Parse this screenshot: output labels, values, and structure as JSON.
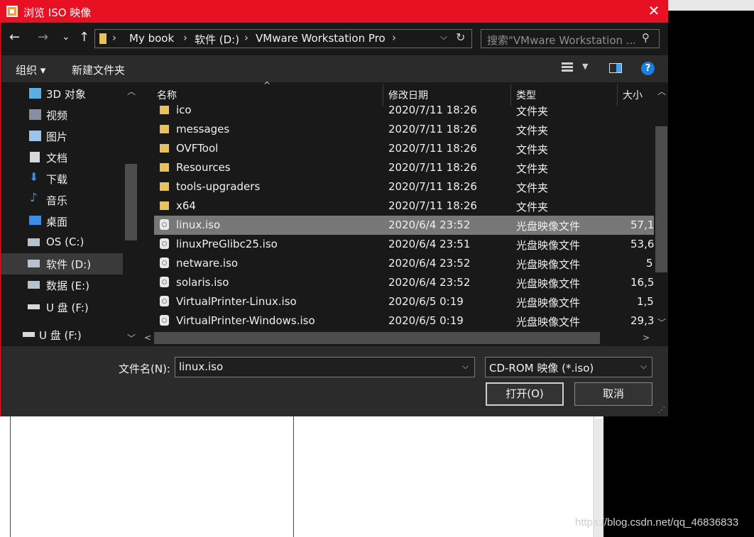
{
  "window": {
    "title": "浏览 ISO 映像",
    "close": "✕"
  },
  "nav_buttons": {
    "back": "←",
    "forward": "→",
    "recent": "⌄",
    "up": "↑"
  },
  "address": {
    "crumbs": [
      "My book",
      "软件 (D:)",
      "VMware Workstation Pro"
    ],
    "separator": "›",
    "dropdown": "⌵",
    "refresh": "↻"
  },
  "search": {
    "placeholder": "搜索\"VMware Workstation ...",
    "icon": "search-icon"
  },
  "toolbar": {
    "organize": "组织 ▾",
    "new_folder": "新建文件夹",
    "help": "?"
  },
  "sidebar": {
    "items": [
      {
        "label": "3D 对象",
        "icon": "3d-objects-icon"
      },
      {
        "label": "视频",
        "icon": "video-icon"
      },
      {
        "label": "图片",
        "icon": "pictures-icon"
      },
      {
        "label": "文档",
        "icon": "documents-icon"
      },
      {
        "label": "下载",
        "icon": "downloads-icon"
      },
      {
        "label": "音乐",
        "icon": "music-icon"
      },
      {
        "label": "桌面",
        "icon": "desktop-icon"
      },
      {
        "label": "OS (C:)",
        "icon": "drive-icon"
      },
      {
        "label": "软件 (D:)",
        "icon": "drive-icon",
        "selected": true
      },
      {
        "label": "数据 (E:)",
        "icon": "drive-icon"
      },
      {
        "label": "U 盘 (F:)",
        "icon": "usb-drive-icon"
      },
      {
        "label": "U 盘 (F:)",
        "icon": "usb-drive-icon"
      }
    ]
  },
  "columns": {
    "name": "名称",
    "date": "修改日期",
    "type": "类型",
    "size": "大小"
  },
  "files": [
    {
      "name": "ico",
      "date": "2020/7/11 18:26",
      "type": "文件夹",
      "size": "",
      "kind": "folder"
    },
    {
      "name": "messages",
      "date": "2020/7/11 18:26",
      "type": "文件夹",
      "size": "",
      "kind": "folder"
    },
    {
      "name": "OVFTool",
      "date": "2020/7/11 18:26",
      "type": "文件夹",
      "size": "",
      "kind": "folder"
    },
    {
      "name": "Resources",
      "date": "2020/7/11 18:26",
      "type": "文件夹",
      "size": "",
      "kind": "folder"
    },
    {
      "name": "tools-upgraders",
      "date": "2020/7/11 18:26",
      "type": "文件夹",
      "size": "",
      "kind": "folder"
    },
    {
      "name": "x64",
      "date": "2020/7/11 18:26",
      "type": "文件夹",
      "size": "",
      "kind": "folder"
    },
    {
      "name": "linux.iso",
      "date": "2020/6/4 23:52",
      "type": "光盘映像文件",
      "size": "57,1",
      "kind": "disc",
      "selected": true
    },
    {
      "name": "linuxPreGlibc25.iso",
      "date": "2020/6/4 23:51",
      "type": "光盘映像文件",
      "size": "53,6",
      "kind": "disc"
    },
    {
      "name": "netware.iso",
      "date": "2020/6/4 23:52",
      "type": "光盘映像文件",
      "size": "5",
      "kind": "disc"
    },
    {
      "name": "solaris.iso",
      "date": "2020/6/4 23:52",
      "type": "光盘映像文件",
      "size": "16,5",
      "kind": "disc"
    },
    {
      "name": "VirtualPrinter-Linux.iso",
      "date": "2020/6/5 0:19",
      "type": "光盘映像文件",
      "size": "1,5",
      "kind": "disc"
    },
    {
      "name": "VirtualPrinter-Windows.iso",
      "date": "2020/6/5 0:19",
      "type": "光盘映像文件",
      "size": "29,3",
      "kind": "disc"
    }
  ],
  "bottom": {
    "filename_label": "文件名(N):",
    "filename_value": "linux.iso",
    "filetype_value": "CD-ROM 映像 (*.iso)",
    "open": "打开(O)",
    "cancel": "取消"
  },
  "watermark": "https://blog.csdn.net/qq_46836833"
}
